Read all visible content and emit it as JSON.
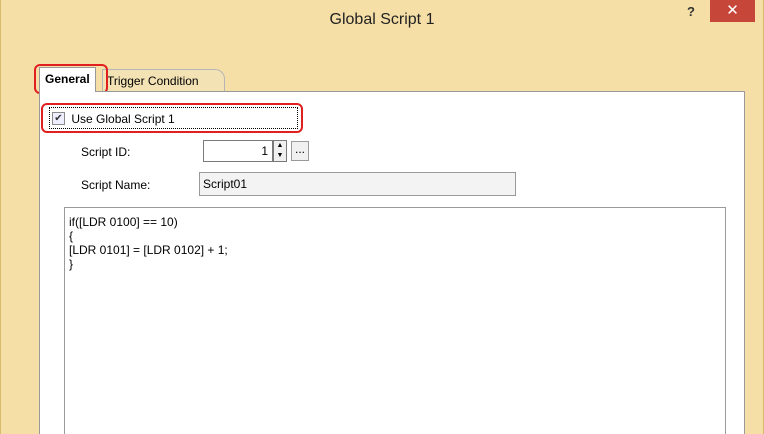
{
  "window": {
    "title": "Global Script 1",
    "help": "?",
    "close": "✕"
  },
  "tabs": [
    {
      "label": "General",
      "active": true
    },
    {
      "label": "Trigger Condition",
      "active": false
    }
  ],
  "use_script": {
    "label": "Use Global Script 1",
    "checked": true,
    "check_glyph": "✔"
  },
  "script_id": {
    "label": "Script ID:",
    "value": "1",
    "up": "▲",
    "down": "▼",
    "browse": "..."
  },
  "script_name": {
    "label": "Script Name:",
    "value": "Script01"
  },
  "editor": {
    "lines": [
      "if([LDR 0100] == 10)",
      "{",
      "[LDR 0101] = [LDR 0102] + 1;",
      "}"
    ]
  },
  "colors": {
    "window_bg": "#f5dfa6",
    "close_bg": "#c7463a",
    "highlight": "#e02020"
  }
}
